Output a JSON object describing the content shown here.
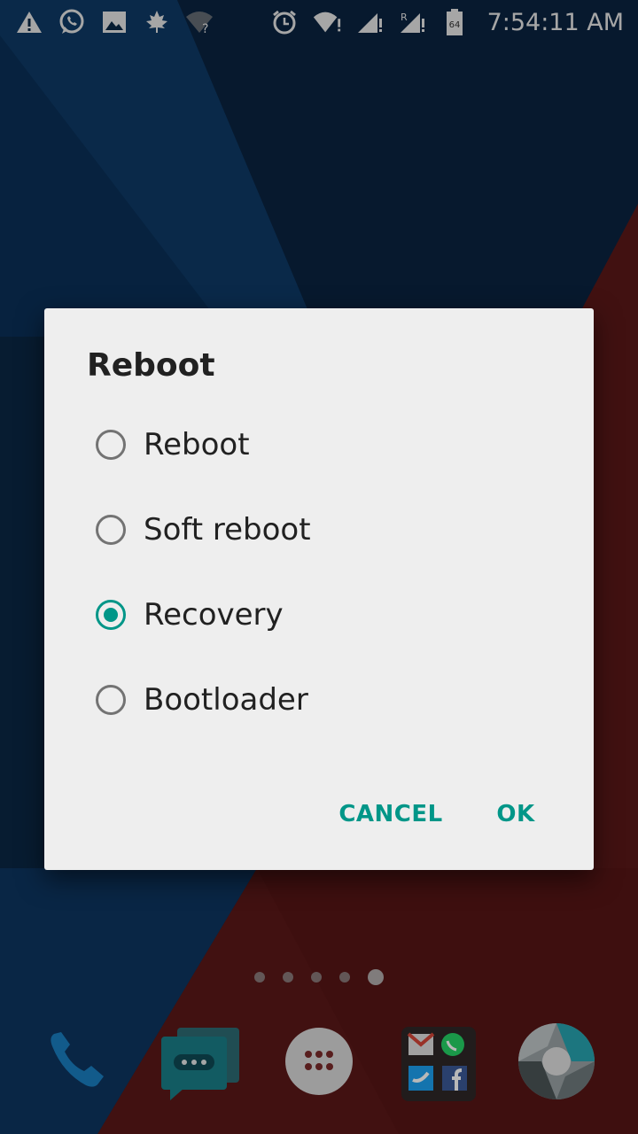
{
  "status_bar": {
    "time": "7:54:11 AM",
    "left_icons": [
      "warning-icon",
      "whatsapp-icon",
      "image-icon",
      "leaf-icon",
      "wifi-unknown-icon"
    ],
    "right_icons": [
      "alarm-icon",
      "wifi-icon",
      "signal-icon",
      "signal-roaming-icon",
      "battery-icon"
    ],
    "battery_text": "64"
  },
  "dialog": {
    "title": "Reboot",
    "options": [
      {
        "label": "Reboot",
        "checked": false
      },
      {
        "label": "Soft reboot",
        "checked": false
      },
      {
        "label": "Recovery",
        "checked": true
      },
      {
        "label": "Bootloader",
        "checked": false
      }
    ],
    "cancel_label": "CANCEL",
    "ok_label": "OK"
  },
  "colors": {
    "accent": "#009688",
    "dialog_bg": "#eeeeee",
    "text_primary": "#212121"
  },
  "home": {
    "page_count": 5,
    "active_page": 5,
    "dock": [
      "phone-icon",
      "messaging-icon",
      "app-drawer-icon",
      "social-folder-icon",
      "camera-icon"
    ]
  }
}
